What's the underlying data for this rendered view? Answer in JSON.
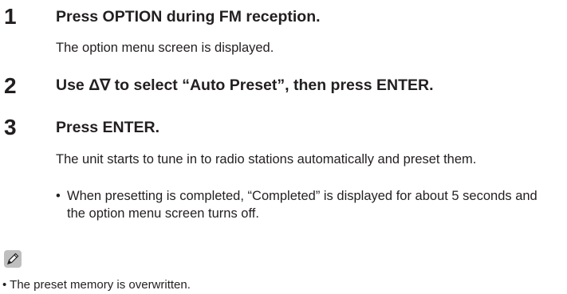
{
  "steps": [
    {
      "number": "1",
      "title": "Press OPTION during FM reception.",
      "body": "The option menu screen is displayed."
    },
    {
      "number": "2",
      "title": "Use Δ∇ to select “Auto Preset”, then press ENTER."
    },
    {
      "number": "3",
      "title": "Press ENTER.",
      "body": "The unit starts to tune in to radio stations automatically and preset them.",
      "bullets": [
        "When presetting is completed, “Completed” is displayed for about 5 seconds and the option menu screen turns off."
      ]
    }
  ],
  "note": {
    "icon": "pencil-icon",
    "bullets": [
      "The preset memory is overwritten."
    ]
  },
  "bullet_glyph": "•"
}
